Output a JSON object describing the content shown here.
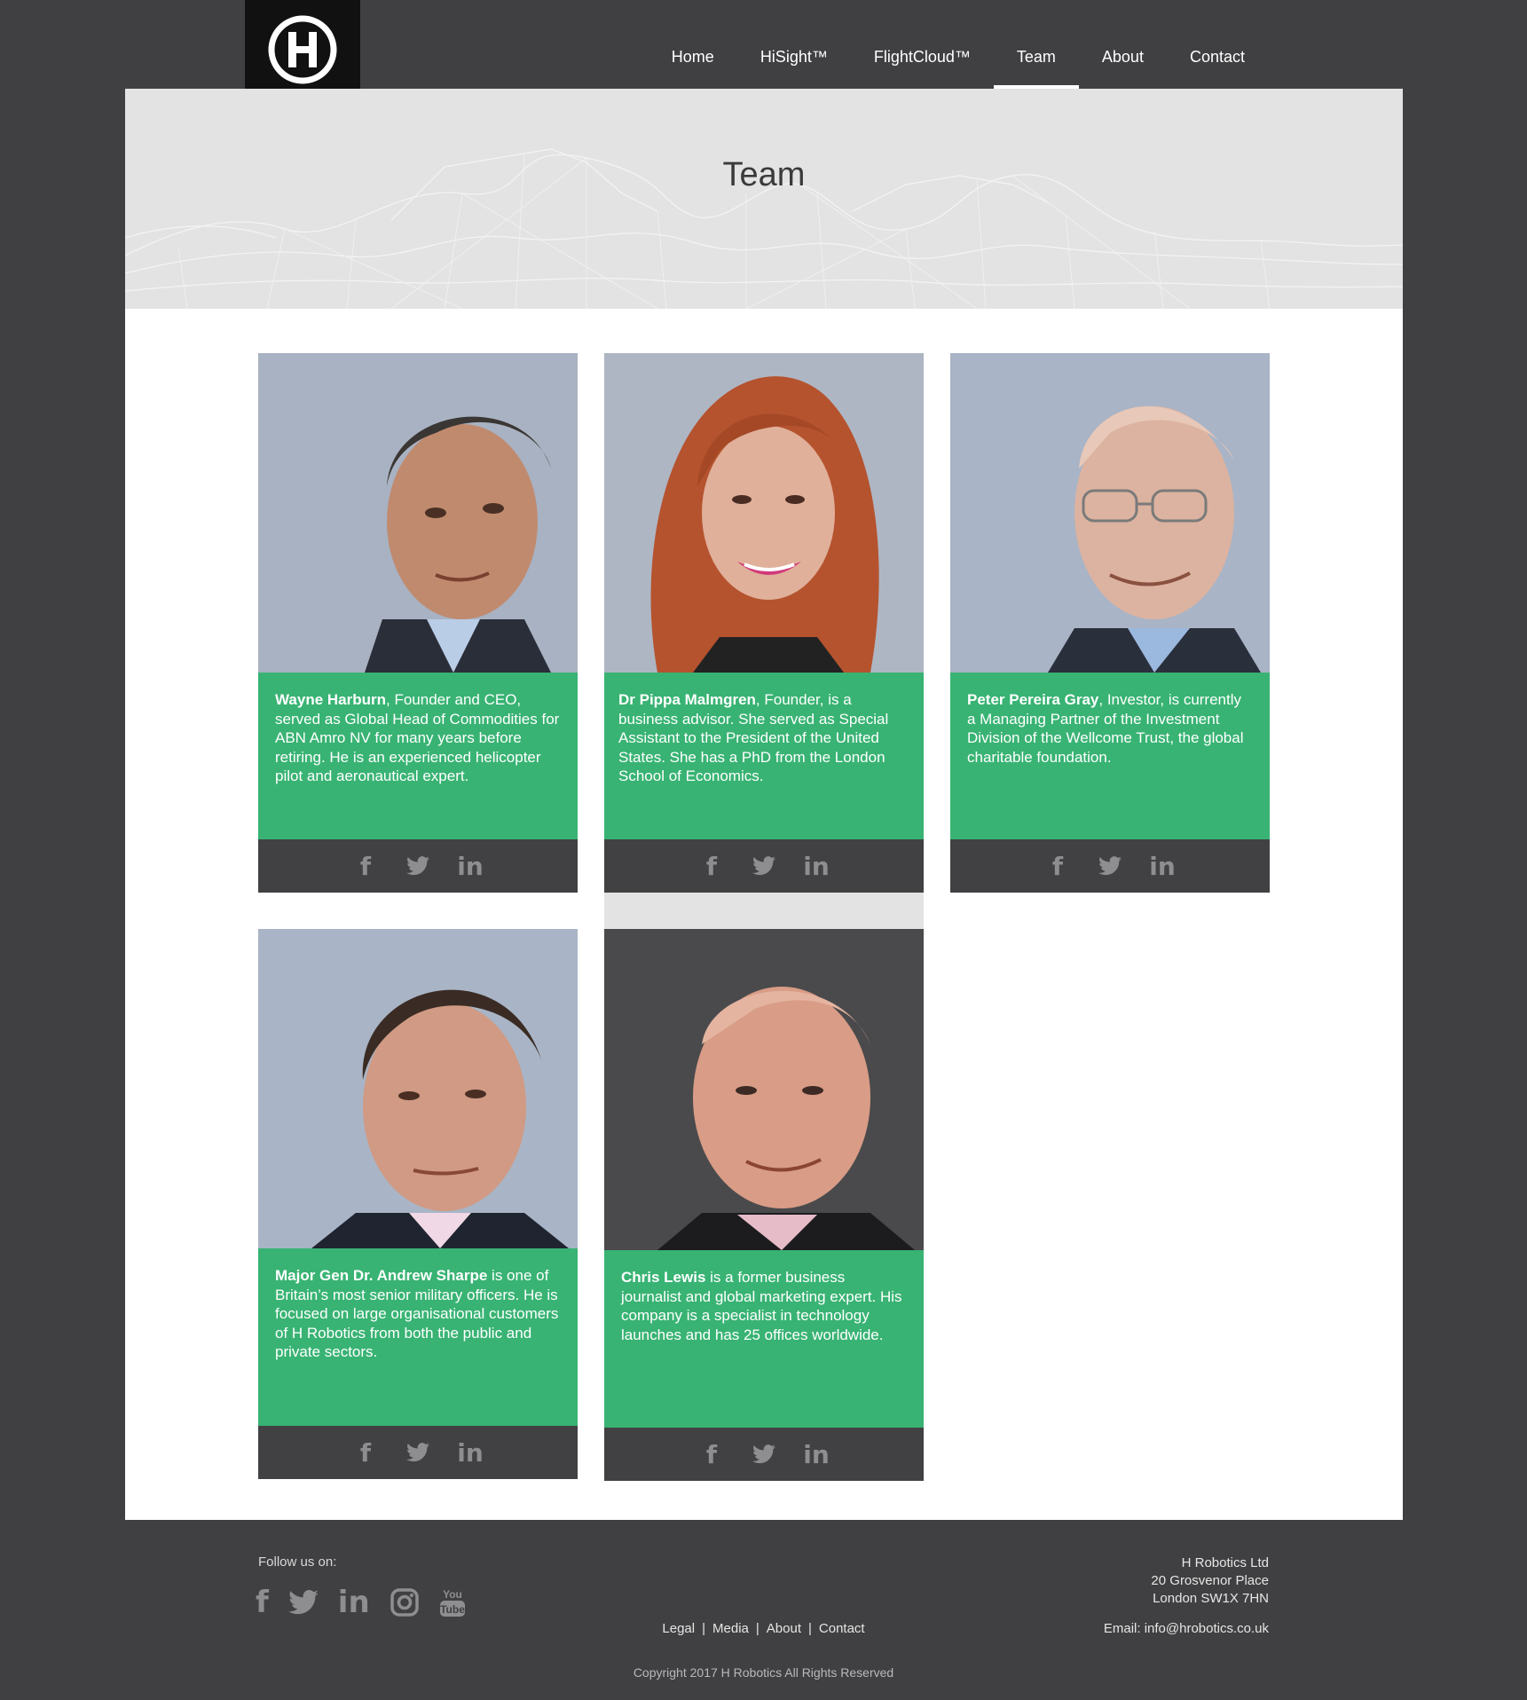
{
  "brand": {
    "name": "robotics",
    "mark": "H"
  },
  "nav": [
    {
      "label": "Home"
    },
    {
      "label": "HiSight™"
    },
    {
      "label": "FlightCloud™"
    },
    {
      "label": "Team",
      "active": true
    },
    {
      "label": "About"
    },
    {
      "label": "Contact"
    }
  ],
  "page": {
    "title": "Team"
  },
  "team": [
    {
      "name": "Wayne Harburn",
      "bio": ", Founder and CEO, served as Global Head of Commodities for ABN Amro NV for many years before retiring. He is an experienced helicopter pilot and aeronautical expert."
    },
    {
      "name": "Dr Pippa Malmgren",
      "bio": ", Founder, is a business advisor. She served as Special Assistant to the President of the United States. She has a PhD from the London School of Economics."
    },
    {
      "name": "Peter Pereira Gray",
      "bio": ", Investor, is currently a Managing Partner of the Investment Division of the Wellcome Trust, the global charitable foundation."
    },
    {
      "name": "Major Gen Dr. Andrew Sharpe",
      "bio": " is one of Britain’s most senior military officers. He is focused on large organisational customers of H Robotics from both the public and private sectors."
    },
    {
      "name": "Chris Lewis",
      "bio": " is a former business journalist and global marketing expert. His company is a specialist in technology launches and has 25 offices worldwide."
    }
  ],
  "social_icons": {
    "facebook": "f",
    "twitter": "twitter",
    "linkedin": "in"
  },
  "footer": {
    "follow_label": "Follow us on:",
    "social": [
      {
        "icon": "facebook-icon",
        "glyph": "f"
      },
      {
        "icon": "twitter-icon",
        "glyph": "twitter"
      },
      {
        "icon": "linkedin-icon",
        "glyph": "in"
      },
      {
        "icon": "instagram-icon",
        "glyph": "instagram"
      },
      {
        "icon": "youtube-icon",
        "glyph": "You Tube"
      }
    ],
    "links": [
      {
        "label": "Legal"
      },
      {
        "label": "Media"
      },
      {
        "label": "About"
      },
      {
        "label": "Contact"
      }
    ],
    "address": [
      "H Robotics Ltd",
      "20 Grosvenor Place",
      "London SW1X 7HN"
    ],
    "email": "Email: info@hrobotics.co.uk",
    "copyright": "Copyright 2017 H Robotics All Rights Reserved"
  },
  "colors": {
    "background": "#404042",
    "accent_green": "#38b373",
    "banner": "#e3e3e3",
    "social_bar": "#414143"
  }
}
